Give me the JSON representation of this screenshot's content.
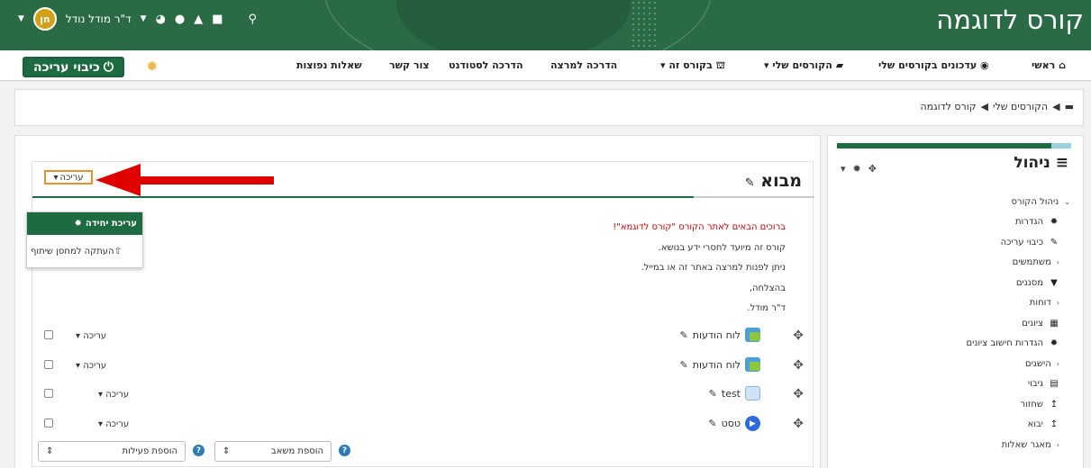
{
  "header": {
    "site_title": "קורס לדוגמה",
    "user_name": "ד\"ר מודל נודל",
    "avatar_initials": "חן",
    "icons": [
      "search-icon",
      "message-icon",
      "chat-icon",
      "bell-icon",
      "globe-icon"
    ]
  },
  "nav": {
    "home": "ראשי",
    "updates": "עדכונים בקורסים שלי",
    "my_courses": "הקורסים שלי",
    "this_course": "בקורס זה",
    "lecturer_guide": "הדרכה למרצה",
    "student_guide": "הדרכה לסטודנט",
    "contact": "צור קשר",
    "faq": "שאלות נפוצות",
    "edit_off": "כיבוי עריכה"
  },
  "breadcrumb": {
    "my_courses": "הקורסים שלי",
    "course": "קורס לדוגמה"
  },
  "section": {
    "title": "מבוא",
    "edit_label": "עריכה",
    "menu": {
      "edit_unit": "עריכת יחידה",
      "copy_to_share": "העתקה למחסן שיתוף"
    },
    "description": [
      "ברוכים הבאים לאתר הקורס \"קורס לדוגמא\"!",
      "קורס זה מיועד לחסרי ידע בנושא.",
      "ניתן לפנות למרצה באתר זה או במייל.",
      "בהצלחה,",
      "ד\"ר מודל."
    ],
    "activities": [
      {
        "name": "לוח הודעות",
        "edit": "עריכה",
        "type": "forum"
      },
      {
        "name": "לוח הודעות",
        "edit": "עריכה",
        "type": "forum"
      },
      {
        "name": "test",
        "edit": "עריכה",
        "type": "page"
      },
      {
        "name": "טסט",
        "edit": "עריכה",
        "type": "quiz"
      }
    ],
    "add_resource": "הוספת משאב",
    "add_activity": "הוספת פעילות"
  },
  "sidebar": {
    "title": "ניהול",
    "items": [
      {
        "label": "ניהול הקורס"
      },
      {
        "label": "הגדרות"
      },
      {
        "label": "כיבוי עריכה"
      },
      {
        "label": "משתמשים"
      },
      {
        "label": "מסננים"
      },
      {
        "label": "דוחות"
      },
      {
        "label": "ציונים"
      },
      {
        "label": "הגדרות חישוב ציונים"
      },
      {
        "label": "הישגים"
      },
      {
        "label": "גיבוי"
      },
      {
        "label": "שחזור"
      },
      {
        "label": "יבוא"
      },
      {
        "label": "מאגר שאלות"
      }
    ]
  },
  "colors": {
    "brand_green": "#2a6b45",
    "edit_button": "#1d6b40",
    "arrow_red": "#e10000",
    "highlight_orange": "#e8902a"
  }
}
